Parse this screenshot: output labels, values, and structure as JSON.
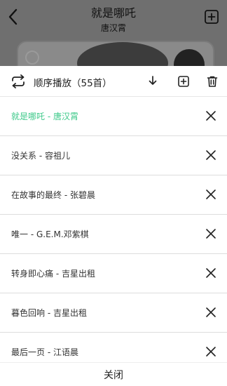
{
  "player": {
    "title": "就是哪吒",
    "artist": "唐汉霄",
    "back_icon": "chevron-left-icon",
    "add_icon": "add-square-icon"
  },
  "queue_sheet": {
    "mode_label": "顺序播放（55首）",
    "mode_icon": "repeat-icon",
    "header_icons": [
      "download-icon",
      "add-square-icon",
      "trash-icon"
    ],
    "items": [
      {
        "label": "就是哪吒 - 唐汉霄",
        "active": true
      },
      {
        "label": "没关系 - 容祖儿",
        "active": false
      },
      {
        "label": "在故事的最终 - 张碧晨",
        "active": false
      },
      {
        "label": "唯一 - G.E.M.邓紫棋",
        "active": false
      },
      {
        "label": "转身即心痛 - 吉星出租",
        "active": false
      },
      {
        "label": "暮色回响 - 吉星出租",
        "active": false
      },
      {
        "label": "最后一页 - 江语晨",
        "active": false
      }
    ],
    "close_label": "关闭"
  },
  "colors": {
    "active": "#3ec98a",
    "text": "#222222",
    "divider": "#dddddd",
    "backdrop": "#6f6f6f"
  }
}
